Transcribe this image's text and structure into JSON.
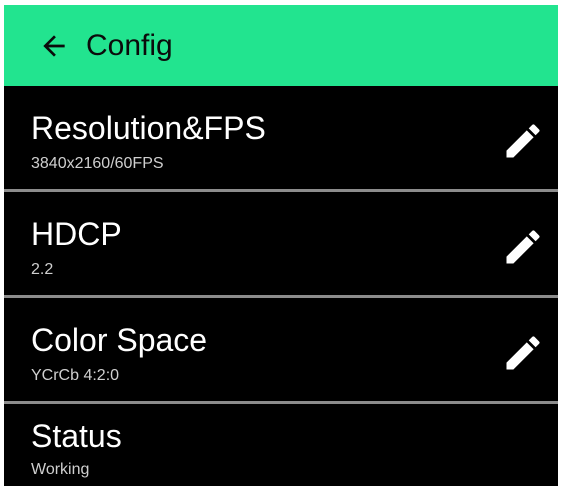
{
  "appbar": {
    "title": "Config",
    "back_icon": "arrow-back-icon",
    "color": "#22e48f"
  },
  "settings": [
    {
      "label": "Resolution&FPS",
      "value": "3840x2160/60FPS",
      "icon": "pencil-edit-icon"
    },
    {
      "label": "HDCP",
      "value": "2.2",
      "icon": "pencil-edit-icon"
    },
    {
      "label": "Color Space",
      "value": "YCrCb 4:2:0",
      "icon": "pencil-edit-icon"
    },
    {
      "label": "Status",
      "value": "Working"
    }
  ]
}
